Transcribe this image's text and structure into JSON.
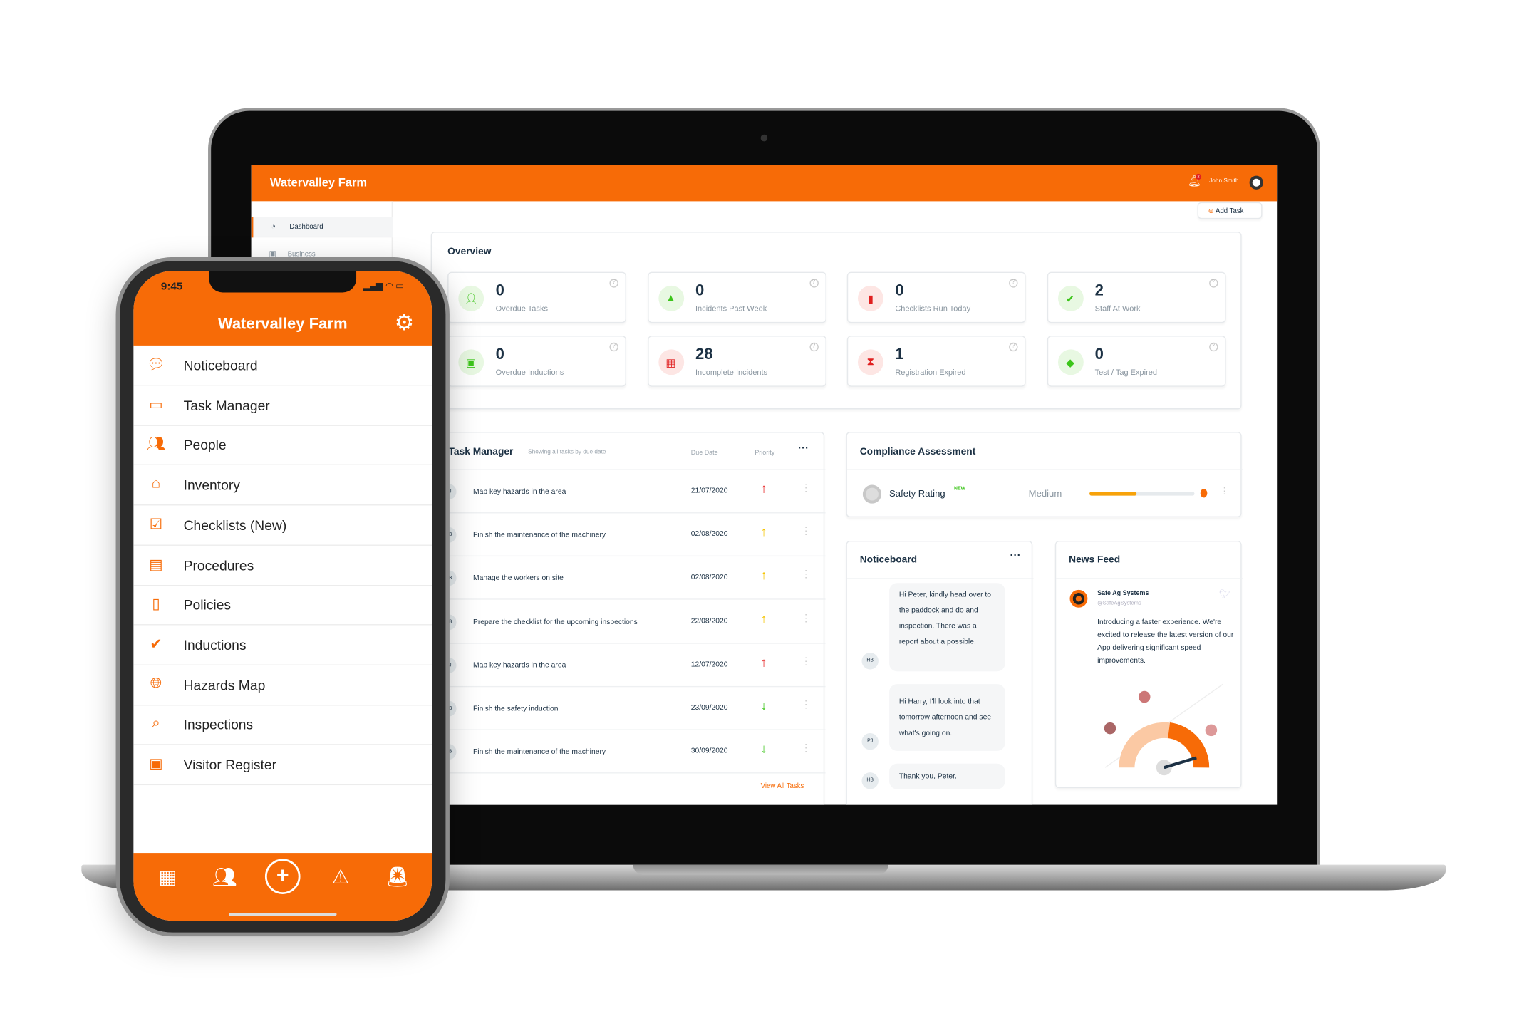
{
  "desktop": {
    "app_title": "Watervalley Farm",
    "user_name": "John Smith",
    "notification_count": "2",
    "sidebar": {
      "items": [
        {
          "label": "Dashboard",
          "icon": "dashboard-icon",
          "active": true
        },
        {
          "label": "Business",
          "icon": "building-icon"
        }
      ]
    },
    "add_task_label": "Add Task",
    "overview": {
      "title": "Overview",
      "stats": [
        {
          "value": "0",
          "label": "Overdue Tasks",
          "icon": "user-clock-icon",
          "color": "#3cc51a",
          "bg": "#e8f8e2"
        },
        {
          "value": "0",
          "label": "Incidents Past Week",
          "icon": "warning-icon",
          "color": "#3cc51a",
          "bg": "#e8f8e2"
        },
        {
          "value": "0",
          "label": "Checklists Run Today",
          "icon": "clipboard-icon",
          "color": "#e02020",
          "bg": "#fde6e4"
        },
        {
          "value": "2",
          "label": "Staff At Work",
          "icon": "user-check-icon",
          "color": "#3cc51a",
          "bg": "#e8f8e2"
        },
        {
          "value": "0",
          "label": "Overdue Inductions",
          "icon": "briefcase-clock-icon",
          "color": "#3cc51a",
          "bg": "#e8f8e2"
        },
        {
          "value": "28",
          "label": "Incomplete Incidents",
          "icon": "calendar-icon",
          "color": "#e02020",
          "bg": "#fde6e4"
        },
        {
          "value": "1",
          "label": "Registration Expired",
          "icon": "hourglass-icon",
          "color": "#e02020",
          "bg": "#fde6e4"
        },
        {
          "value": "0",
          "label": "Test / Tag Expired",
          "icon": "tag-icon",
          "color": "#3cc51a",
          "bg": "#e8f8e2"
        }
      ]
    },
    "task_manager": {
      "title": "Task Manager",
      "subtitle": "Showing all tasks by due date",
      "col_due": "Due Date",
      "col_priority": "Priority",
      "view_all": "View All Tasks",
      "rows": [
        {
          "initials": "PJ",
          "task": "Map key hazards in the area",
          "due": "21/07/2020",
          "priority": "high",
          "arrow": "↑",
          "color": "#e51b1b"
        },
        {
          "initials": "HB",
          "task": "Finish the maintenance of the machinery",
          "due": "02/08/2020",
          "priority": "medium",
          "arrow": "↑",
          "color": "#f5c400"
        },
        {
          "initials": "HB",
          "task": "Manage the workers on site",
          "due": "02/08/2020",
          "priority": "medium",
          "arrow": "↑",
          "color": "#f5c400"
        },
        {
          "initials": "HB",
          "task": "Prepare the checklist for the upcoming inspections",
          "due": "22/08/2020",
          "priority": "medium",
          "arrow": "↑",
          "color": "#f5c400"
        },
        {
          "initials": "PJ",
          "task": "Map key hazards in the area",
          "due": "12/07/2020",
          "priority": "high",
          "arrow": "↑",
          "color": "#e51b1b"
        },
        {
          "initials": "HB",
          "task": "Finish the safety induction",
          "due": "23/09/2020",
          "priority": "low",
          "arrow": "↓",
          "color": "#3cc51a"
        },
        {
          "initials": "HB",
          "task": "Finish the maintenance of the machinery",
          "due": "30/09/2020",
          "priority": "low",
          "arrow": "↓",
          "color": "#3cc51a"
        }
      ]
    },
    "compliance": {
      "title": "Compliance Assessment",
      "label": "Safety Rating",
      "badge": "NEW",
      "level": "Medium",
      "progress_percent": 45
    },
    "noticeboard": {
      "title": "Noticeboard",
      "messages": [
        {
          "initials": "HB",
          "text": "Hi Peter, kindly head over to the paddock and do and inspection. There was a report about a possible."
        },
        {
          "initials": "PJ",
          "text": "Hi Harry, I'll look into that tomorrow afternoon and see what's going on."
        },
        {
          "initials": "HB",
          "text": "Thank you, Peter."
        }
      ]
    },
    "news_feed": {
      "title": "News Feed",
      "author": "Safe Ag Systems",
      "handle": "@SafeAgSystems",
      "text": "Introducing a faster experience. We're excited to release the latest version of our App delivering significant speed improvements."
    }
  },
  "mobile": {
    "time": "9:45",
    "title": "Watervalley Farm",
    "menu": [
      {
        "label": "Noticeboard",
        "icon": "chat-icon"
      },
      {
        "label": "Task Manager",
        "icon": "task-icon"
      },
      {
        "label": "People",
        "icon": "people-icon"
      },
      {
        "label": "Inventory",
        "icon": "warehouse-icon"
      },
      {
        "label": "Checklists (New)",
        "icon": "checklist-icon"
      },
      {
        "label": "Procedures",
        "icon": "book-icon"
      },
      {
        "label": "Policies",
        "icon": "document-icon"
      },
      {
        "label": "Inductions",
        "icon": "check-circle-icon"
      },
      {
        "label": "Hazards Map",
        "icon": "globe-warning-icon"
      },
      {
        "label": "Inspections",
        "icon": "magnifier-icon"
      },
      {
        "label": "Visitor Register",
        "icon": "contact-card-icon"
      }
    ],
    "bottom_bar": [
      "qr-code-icon",
      "team-icon",
      "add-icon",
      "warning-icon",
      "siren-icon"
    ]
  },
  "colors": {
    "accent": "#f76b07",
    "text": "#1c3144"
  }
}
